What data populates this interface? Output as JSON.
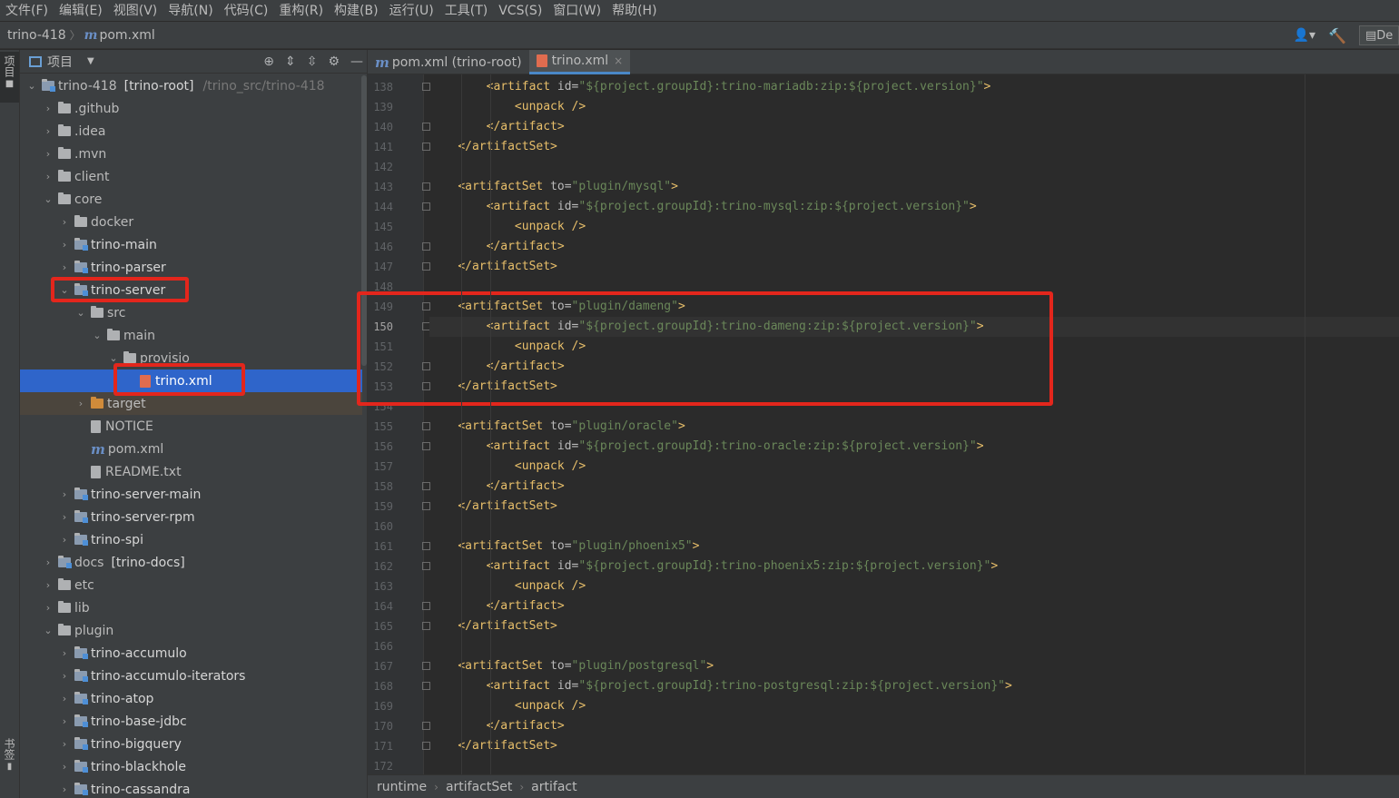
{
  "menu": [
    "文件(F)",
    "编辑(E)",
    "视图(V)",
    "导航(N)",
    "代码(C)",
    "重构(R)",
    "构建(B)",
    "运行(U)",
    "工具(T)",
    "VCS(S)",
    "窗口(W)",
    "帮助(H)"
  ],
  "navbar": {
    "project": "trino-418",
    "file": "pom.xml",
    "run_config": "De"
  },
  "stripe": {
    "project": "项目",
    "bookmarks": "书签"
  },
  "project_panel": {
    "title": "项目"
  },
  "tree": [
    {
      "label": "trino-418",
      "extra": "[trino-root]",
      "path": "/trino_src/trino-418",
      "indent": 0,
      "arrow": "open",
      "icon": "module"
    },
    {
      "label": ".github",
      "indent": 1,
      "arrow": "closed",
      "icon": "folder"
    },
    {
      "label": ".idea",
      "indent": 1,
      "arrow": "closed",
      "icon": "folder"
    },
    {
      "label": ".mvn",
      "indent": 1,
      "arrow": "closed",
      "icon": "folder"
    },
    {
      "label": "client",
      "indent": 1,
      "arrow": "closed",
      "icon": "folder"
    },
    {
      "label": "core",
      "indent": 1,
      "arrow": "open",
      "icon": "folder"
    },
    {
      "label": "docker",
      "indent": 2,
      "arrow": "closed",
      "icon": "folder"
    },
    {
      "label": "trino-main",
      "indent": 2,
      "arrow": "closed",
      "icon": "module",
      "bold": true
    },
    {
      "label": "trino-parser",
      "indent": 2,
      "arrow": "closed",
      "icon": "module",
      "bold": true
    },
    {
      "label": "trino-server",
      "indent": 2,
      "arrow": "open",
      "icon": "module",
      "bold": true
    },
    {
      "label": "src",
      "indent": 3,
      "arrow": "open",
      "icon": "folder"
    },
    {
      "label": "main",
      "indent": 4,
      "arrow": "open",
      "icon": "folder"
    },
    {
      "label": "provisio",
      "indent": 5,
      "arrow": "open",
      "icon": "folder"
    },
    {
      "label": "trino.xml",
      "indent": 6,
      "arrow": "none",
      "icon": "xml",
      "selected": true
    },
    {
      "label": "target",
      "indent": 3,
      "arrow": "closed",
      "icon": "orange",
      "excluded": true
    },
    {
      "label": "NOTICE",
      "indent": 3,
      "arrow": "none",
      "icon": "file"
    },
    {
      "label": "pom.xml",
      "indent": 3,
      "arrow": "none",
      "icon": "maven"
    },
    {
      "label": "README.txt",
      "indent": 3,
      "arrow": "none",
      "icon": "file"
    },
    {
      "label": "trino-server-main",
      "indent": 2,
      "arrow": "closed",
      "icon": "module",
      "bold": true
    },
    {
      "label": "trino-server-rpm",
      "indent": 2,
      "arrow": "closed",
      "icon": "module",
      "bold": true
    },
    {
      "label": "trino-spi",
      "indent": 2,
      "arrow": "closed",
      "icon": "module",
      "bold": true
    },
    {
      "label": "docs",
      "extra": "[trino-docs]",
      "indent": 1,
      "arrow": "closed",
      "icon": "module"
    },
    {
      "label": "etc",
      "indent": 1,
      "arrow": "closed",
      "icon": "folder"
    },
    {
      "label": "lib",
      "indent": 1,
      "arrow": "closed",
      "icon": "folder"
    },
    {
      "label": "plugin",
      "indent": 1,
      "arrow": "open",
      "icon": "folder"
    },
    {
      "label": "trino-accumulo",
      "indent": 2,
      "arrow": "closed",
      "icon": "module",
      "bold": true
    },
    {
      "label": "trino-accumulo-iterators",
      "indent": 2,
      "arrow": "closed",
      "icon": "module",
      "bold": true
    },
    {
      "label": "trino-atop",
      "indent": 2,
      "arrow": "closed",
      "icon": "module",
      "bold": true
    },
    {
      "label": "trino-base-jdbc",
      "indent": 2,
      "arrow": "closed",
      "icon": "module",
      "bold": true
    },
    {
      "label": "trino-bigquery",
      "indent": 2,
      "arrow": "closed",
      "icon": "module",
      "bold": true
    },
    {
      "label": "trino-blackhole",
      "indent": 2,
      "arrow": "closed",
      "icon": "module",
      "bold": true
    },
    {
      "label": "trino-cassandra",
      "indent": 2,
      "arrow": "closed",
      "icon": "module",
      "bold": true
    }
  ],
  "tabs": [
    {
      "label": "pom.xml (trino-root)",
      "icon": "maven",
      "active": false
    },
    {
      "label": "trino.xml",
      "icon": "xml",
      "active": true
    }
  ],
  "code_lines": [
    {
      "n": "138",
      "indent": 2,
      "kind": "artifact-open",
      "id": "${project.groupId}:trino-mariadb:zip:${project.version}"
    },
    {
      "n": "139",
      "indent": 3,
      "kind": "unpack"
    },
    {
      "n": "140",
      "indent": 2,
      "kind": "artifact-close"
    },
    {
      "n": "141",
      "indent": 1,
      "kind": "set-close"
    },
    {
      "n": "142",
      "indent": 0,
      "kind": "blank"
    },
    {
      "n": "143",
      "indent": 1,
      "kind": "set-open",
      "to": "plugin/mysql"
    },
    {
      "n": "144",
      "indent": 2,
      "kind": "artifact-open",
      "id": "${project.groupId}:trino-mysql:zip:${project.version}"
    },
    {
      "n": "145",
      "indent": 3,
      "kind": "unpack"
    },
    {
      "n": "146",
      "indent": 2,
      "kind": "artifact-close"
    },
    {
      "n": "147",
      "indent": 1,
      "kind": "set-close"
    },
    {
      "n": "148",
      "indent": 0,
      "kind": "blank"
    },
    {
      "n": "149",
      "indent": 1,
      "kind": "set-open",
      "to": "plugin/dameng"
    },
    {
      "n": "150",
      "indent": 2,
      "kind": "artifact-open",
      "id": "${project.groupId}:trino-dameng:zip:${project.version}",
      "current": true
    },
    {
      "n": "151",
      "indent": 3,
      "kind": "unpack"
    },
    {
      "n": "152",
      "indent": 2,
      "kind": "artifact-close"
    },
    {
      "n": "153",
      "indent": 1,
      "kind": "set-close"
    },
    {
      "n": "154",
      "indent": 0,
      "kind": "blank"
    },
    {
      "n": "155",
      "indent": 1,
      "kind": "set-open",
      "to": "plugin/oracle"
    },
    {
      "n": "156",
      "indent": 2,
      "kind": "artifact-open",
      "id": "${project.groupId}:trino-oracle:zip:${project.version}"
    },
    {
      "n": "157",
      "indent": 3,
      "kind": "unpack"
    },
    {
      "n": "158",
      "indent": 2,
      "kind": "artifact-close"
    },
    {
      "n": "159",
      "indent": 1,
      "kind": "set-close"
    },
    {
      "n": "160",
      "indent": 0,
      "kind": "blank"
    },
    {
      "n": "161",
      "indent": 1,
      "kind": "set-open",
      "to": "plugin/phoenix5"
    },
    {
      "n": "162",
      "indent": 2,
      "kind": "artifact-open",
      "id": "${project.groupId}:trino-phoenix5:zip:${project.version}"
    },
    {
      "n": "163",
      "indent": 3,
      "kind": "unpack"
    },
    {
      "n": "164",
      "indent": 2,
      "kind": "artifact-close"
    },
    {
      "n": "165",
      "indent": 1,
      "kind": "set-close"
    },
    {
      "n": "166",
      "indent": 0,
      "kind": "blank"
    },
    {
      "n": "167",
      "indent": 1,
      "kind": "set-open",
      "to": "plugin/postgresql"
    },
    {
      "n": "168",
      "indent": 2,
      "kind": "artifact-open",
      "id": "${project.groupId}:trino-postgresql:zip:${project.version}"
    },
    {
      "n": "169",
      "indent": 3,
      "kind": "unpack"
    },
    {
      "n": "170",
      "indent": 2,
      "kind": "artifact-close"
    },
    {
      "n": "171",
      "indent": 1,
      "kind": "set-close"
    },
    {
      "n": "172",
      "indent": 0,
      "kind": "blank"
    }
  ],
  "breadcrumbs": [
    "runtime",
    "artifactSet",
    "artifact"
  ],
  "colors": {
    "highlight": "#e3261c",
    "selection": "#2f65ca",
    "tag": "#e8bf6a",
    "string": "#6a8759"
  }
}
